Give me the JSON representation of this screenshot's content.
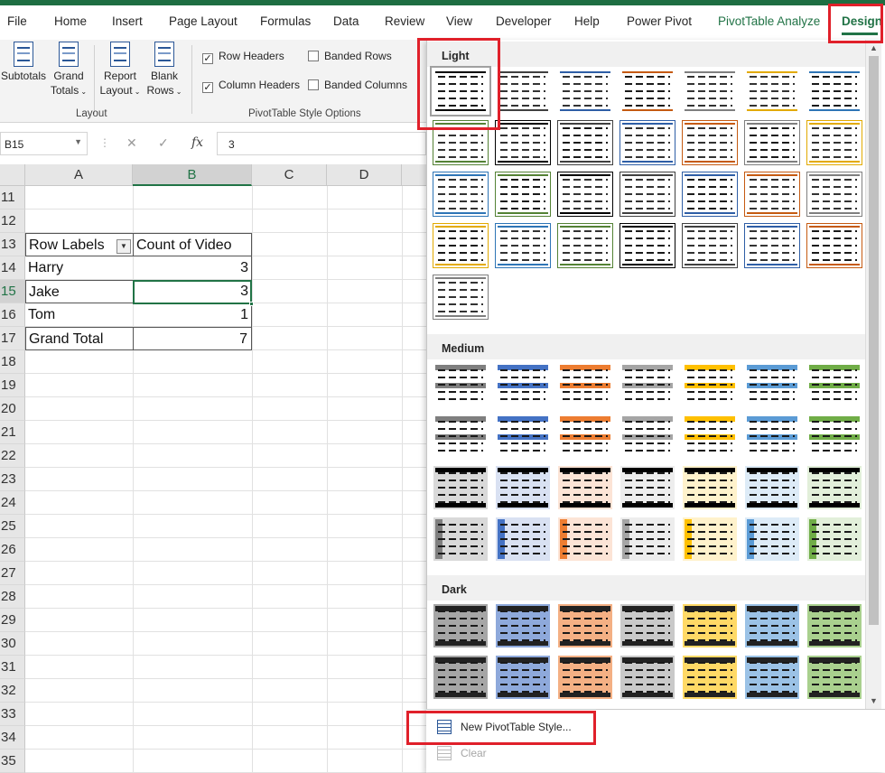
{
  "tabs": [
    "File",
    "Home",
    "Insert",
    "Page Layout",
    "Formulas",
    "Data",
    "Review",
    "View",
    "Developer",
    "Help",
    "Power Pivot",
    "PivotTable Analyze",
    "Design"
  ],
  "ribbon": {
    "subtotals": "Subtotals",
    "grand_totals_1": "Grand",
    "grand_totals_2": "Totals",
    "report_layout_1": "Report",
    "report_layout_2": "Layout",
    "blank_rows_1": "Blank",
    "blank_rows_2": "Rows",
    "layout_group": "Layout",
    "row_headers": "Row Headers",
    "column_headers": "Column Headers",
    "banded_rows": "Banded Rows",
    "banded_columns": "Banded Columns",
    "style_options_group": "PivotTable Style Options",
    "row_headers_checked": true,
    "column_headers_checked": true,
    "banded_rows_checked": false,
    "banded_columns_checked": false
  },
  "formula_bar": {
    "name_box": "B15",
    "fx": "fx",
    "value": "3"
  },
  "grid": {
    "columns": [
      "A",
      "B",
      "C",
      "D"
    ],
    "selected_column": "B",
    "rows": [
      "11",
      "12",
      "13",
      "14",
      "15",
      "16",
      "17",
      "18",
      "19",
      "20",
      "21",
      "22",
      "23",
      "24",
      "25",
      "26",
      "27",
      "28",
      "29",
      "30",
      "31",
      "32",
      "33",
      "34",
      "35"
    ],
    "selected_row": "15",
    "pivot": {
      "header_a": "Row Labels",
      "header_b": "Count of Video",
      "rows": [
        {
          "label": "Harry",
          "value": "3"
        },
        {
          "label": "Jake",
          "value": "3"
        },
        {
          "label": "Tom",
          "value": "1"
        }
      ],
      "total_label": "Grand Total",
      "total_value": "7"
    }
  },
  "gallery": {
    "sections": [
      "Light",
      "Medium",
      "Dark"
    ],
    "new_style": "New PivotTable Style...",
    "clear": "Clear",
    "palette": {
      "light": [
        "#000000",
        "#404040",
        "#2e5ea6",
        "#c55a11",
        "#7f7f7f",
        "#e2aa00",
        "#2e75b6",
        "#548235"
      ],
      "medium": [
        "#7f7f7f",
        "#4472c4",
        "#ed7d31",
        "#a5a5a5",
        "#ffc000",
        "#5b9bd5",
        "#70ad47"
      ],
      "medium_fills": [
        "#d9d9d9",
        "#d9e1f2",
        "#fce4d6",
        "#ededed",
        "#fff2cc",
        "#ddebf7",
        "#e2efda"
      ],
      "dark_fills": [
        "#a6a6a6",
        "#8ea9db",
        "#f4b084",
        "#c9c9c9",
        "#ffd966",
        "#9bc2e6",
        "#a9d08e"
      ]
    }
  }
}
